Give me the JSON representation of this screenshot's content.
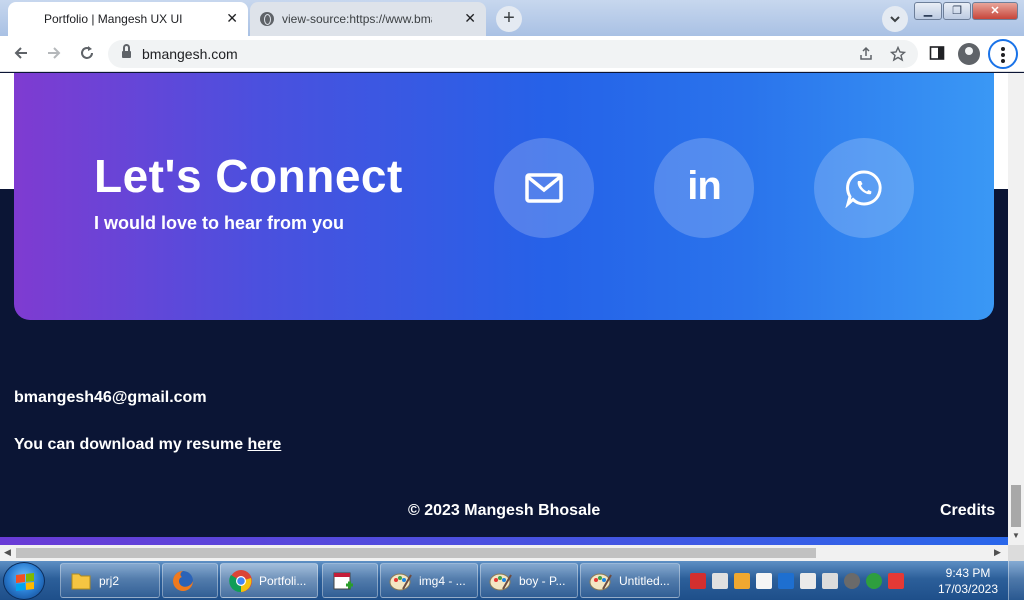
{
  "browser": {
    "tabs": [
      {
        "title": "Portfolio | Mangesh UX UI",
        "active": true
      },
      {
        "title": "view-source:https://www.bmangesh.com",
        "active": false
      }
    ],
    "new_tab_label": "+",
    "close_label": "✕",
    "tab_search_label": "⌄",
    "url": "bmangesh.com"
  },
  "page": {
    "connect_title": "Let's Connect",
    "connect_subtitle": "I would love to hear from you",
    "social": [
      {
        "name": "mail-icon"
      },
      {
        "name": "linkedin-icon",
        "label": "in"
      },
      {
        "name": "whatsapp-icon"
      }
    ],
    "footer": {
      "email": "bmangesh46@gmail.com",
      "resume_text": "You can download my resume ",
      "resume_link": "here",
      "copyright": "© 2023 Mangesh Bhosale",
      "credits": "Credits"
    },
    "colors": {
      "gradient_start": "#7f3bd1",
      "gradient_end": "#3a98f5",
      "footer_bg": "#0b1535"
    }
  },
  "taskbar": {
    "items": [
      {
        "name": "explorer-folder",
        "label": "prj2"
      },
      {
        "name": "firefox",
        "label": ""
      },
      {
        "name": "chrome",
        "label": "Portfoli..."
      },
      {
        "name": "app-icon",
        "label": ""
      },
      {
        "name": "paint-1",
        "label": "img4 - ..."
      },
      {
        "name": "paint-2",
        "label": "boy - P..."
      },
      {
        "name": "paint-3",
        "label": "Untitled..."
      }
    ],
    "clock_time": "9:43 PM",
    "clock_date": "17/03/2023"
  }
}
